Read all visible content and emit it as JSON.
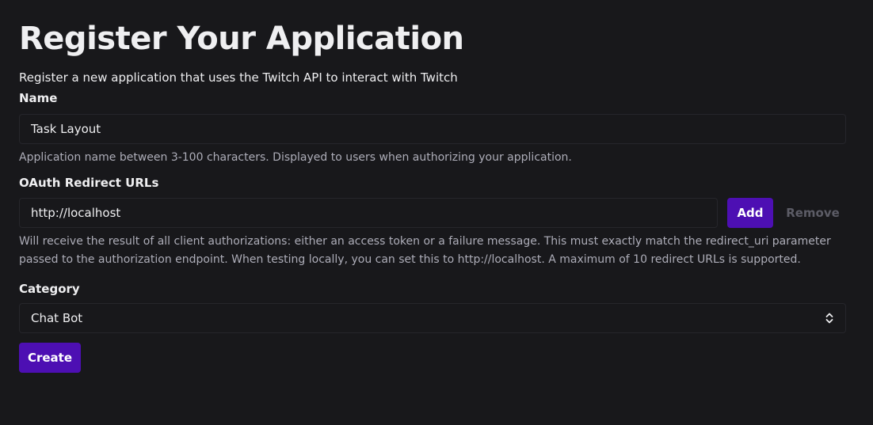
{
  "page": {
    "title": "Register Your Application",
    "subtitle": "Register a new application that uses the Twitch API to interact with Twitch"
  },
  "name": {
    "label": "Name",
    "value": "Task Layout",
    "help": "Application name between 3-100 characters. Displayed to users when authorizing your application."
  },
  "oauth": {
    "label": "OAuth Redirect URLs",
    "value": "http://localhost",
    "add_label": "Add",
    "remove_label": "Remove",
    "help_line1": "Will receive the result of all client authorizations: either an access token or a failure message. This must exactly match the redirect_uri parameter",
    "help_line2": "passed to the authorization endpoint. When testing locally, you can set this to http://localhost. A maximum of 10 redirect URLs is supported."
  },
  "category": {
    "label": "Category",
    "selected": "Chat Bot",
    "icon": "chevron-up-down-icon"
  },
  "actions": {
    "create_label": "Create"
  },
  "colors": {
    "background": "#18181b",
    "text": "#efeff1",
    "muted_text": "#adadb8",
    "primary": "#4d0fb3",
    "disabled": "#5c5c66",
    "field_border": "#26262b"
  }
}
